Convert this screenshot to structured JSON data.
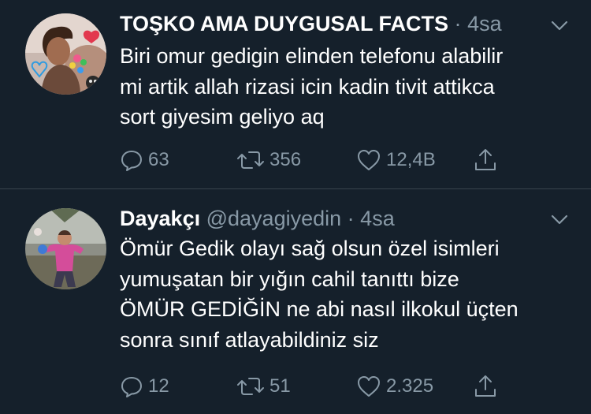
{
  "tweets": [
    {
      "display_name": "TOŞKO AMA DUYGUSAL FACTS",
      "handle": "",
      "dot": "·",
      "time": "4sa",
      "lines": [
        "Biri omur gedigin elinden telefonu alabilir",
        "mi artik allah rizasi icin kadin tivit attikca",
        "sort giyesim geliyo aq"
      ],
      "replies": "63",
      "retweets": "356",
      "likes": "12,4B"
    },
    {
      "display_name": "Dayakçı",
      "handle": "@dayagiyedin",
      "dot": "·",
      "time": "4sa",
      "lines": [
        "Ömür Gedik olayı sağ olsun özel isimleri",
        "yumuşatan bir yığın cahil tanıttı bize",
        "ÖMÜR GEDİĞİN ne abi nasıl ilkokul üçten",
        "sonra sınıf atlayabildiniz siz"
      ],
      "replies": "12",
      "retweets": "51",
      "likes": "2.325"
    }
  ],
  "icons": {
    "reply": "reply-icon",
    "retweet": "retweet-icon",
    "like": "heart-icon",
    "share": "share-icon",
    "caret": "chevron-down-icon"
  },
  "colors": {
    "background": "#15202b",
    "muted": "#8899a6",
    "divider": "#38444d",
    "text": "#ffffff"
  }
}
